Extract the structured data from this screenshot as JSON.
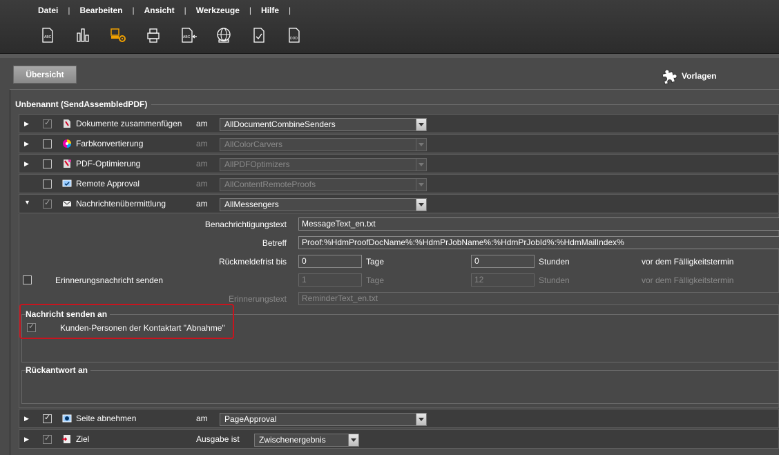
{
  "menu": {
    "items": [
      "Datei",
      "Bearbeiten",
      "Ansicht",
      "Werkzeuge",
      "Hilfe"
    ]
  },
  "toolbar": {
    "icons": [
      "document-abc-icon",
      "chart-icon",
      "gear-printer-icon",
      "device-icon",
      "document-arrow-icon",
      "globe-icon",
      "document-check-icon",
      "document-ddd-icon"
    ]
  },
  "header": {
    "tab_label": "Übersicht",
    "templates_label": "Vorlagen"
  },
  "workflow": {
    "title": "Unbenannt (SendAssembledPDF)",
    "rows": [
      {
        "label": "Dokumente zusammenfügen",
        "am": "am",
        "select": "AllDocumentCombineSenders",
        "checked": true,
        "enabled": true
      },
      {
        "label": "Farbkonvertierung",
        "am": "am",
        "select": "AllColorCarvers",
        "checked": false,
        "enabled": false
      },
      {
        "label": "PDF-Optimierung",
        "am": "am",
        "select": "AllPDFOptimizers",
        "checked": false,
        "enabled": false
      },
      {
        "label": "Remote Approval",
        "am": "am",
        "select": "AllContentRemoteProofs",
        "checked": false,
        "enabled": false
      },
      {
        "label": "Nachrichtenübermittlung",
        "am": "am",
        "select": "AllMessengers",
        "checked": true,
        "enabled": true
      },
      {
        "label": "Seite abnehmen",
        "am": "am",
        "select": "PageApproval",
        "checked": true,
        "enabled": true
      },
      {
        "label": "Ziel",
        "am": "Ausgabe ist",
        "select": "Zwischenergebnis",
        "checked": true,
        "enabled": true
      }
    ]
  },
  "messaging": {
    "notification_label": "Benachrichtigungstext",
    "notification_value": "MessageText_en.txt",
    "subject_label": "Betreff",
    "subject_value": "Proof:%HdmProofDocName%:%HdmPrJobName%:%HdmPrJobId%:%HdmMailIndex%",
    "response_label": "Rückmeldefrist bis",
    "response_days": "0",
    "days_unit": "Tage",
    "response_hours": "0",
    "hours_unit": "Stunden",
    "before_due": "vor dem Fälligkeitstermin",
    "reminder_label": "Erinnerungsnachricht senden",
    "reminder_days": "1",
    "reminder_hours": "12",
    "reminder_text_label": "Erinnerungstext",
    "reminder_text_value": "ReminderText_en.txt",
    "send_to_title": "Nachricht senden an",
    "send_to_option": "Kunden-Personen der Kontaktart \"Abnahme\"",
    "reply_to_title": "Rückantwort an"
  }
}
